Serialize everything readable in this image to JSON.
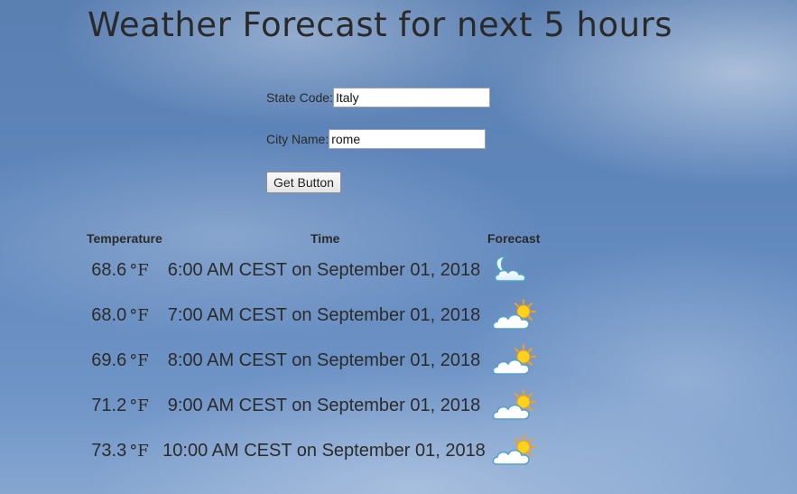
{
  "page": {
    "title": "Weather Forecast for next 5 hours"
  },
  "form": {
    "state_label": "State Code:",
    "state_value": "Italy",
    "city_label": "City Name:",
    "city_value": "rome",
    "button_label": "Get Button"
  },
  "table": {
    "headers": {
      "temperature": "Temperature",
      "time": "Time",
      "forecast": "Forecast"
    },
    "unit": "°F",
    "rows": [
      {
        "temp": "68.6",
        "time": "6:00 AM CEST on September 01, 2018",
        "icon": "night-clear-moon-icon"
      },
      {
        "temp": "68.0",
        "time": "7:00 AM CEST on September 01, 2018",
        "icon": "partly-cloudy-icon"
      },
      {
        "temp": "69.6",
        "time": "8:00 AM CEST on September 01, 2018",
        "icon": "partly-cloudy-icon"
      },
      {
        "temp": "71.2",
        "time": "9:00 AM CEST on September 01, 2018",
        "icon": "partly-cloudy-icon"
      },
      {
        "temp": "73.3",
        "time": "10:00 AM CEST on September 01, 2018",
        "icon": "partly-cloudy-icon"
      }
    ]
  }
}
